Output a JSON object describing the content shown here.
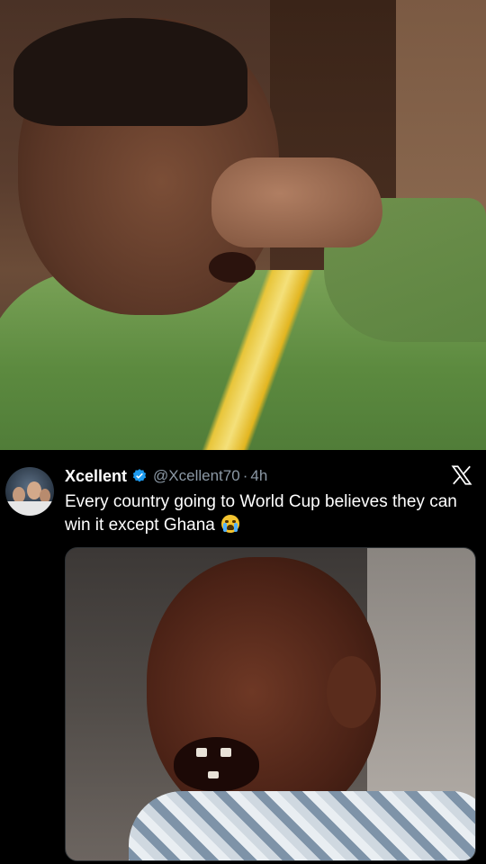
{
  "tweet": {
    "display_name": "Xcellent",
    "handle": "@Xcellent70",
    "separator": "·",
    "time": "4h",
    "text": "Every country going to World Cup believes they can win it except Ghana",
    "emoji": "loudly-crying-face",
    "verified_color": "#1d9bf0"
  },
  "icons": {
    "verified": "verified-badge-icon",
    "platform": "x-logo-icon"
  },
  "colors": {
    "background": "#000000",
    "text_primary": "#ffffff",
    "text_secondary": "#8b98a5"
  }
}
